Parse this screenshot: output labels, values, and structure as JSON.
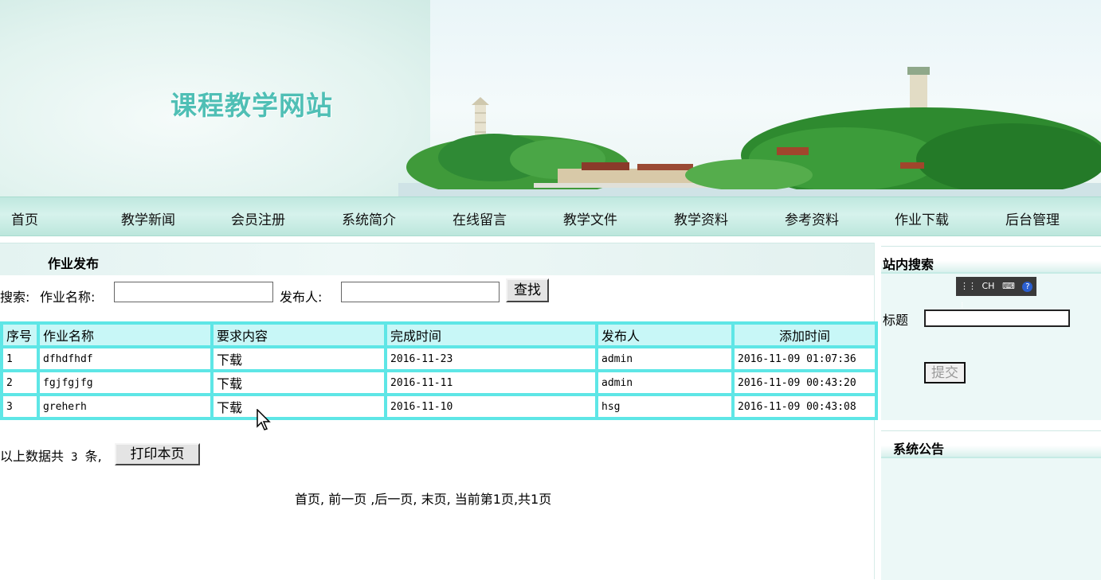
{
  "site": {
    "title": "课程教学网站"
  },
  "nav": [
    "首页",
    "教学新闻",
    "会员注册",
    "系统简介",
    "在线留言",
    "教学文件",
    "教学资料",
    "参考资料",
    "作业下载",
    "后台管理"
  ],
  "section": {
    "title": "作业发布"
  },
  "search": {
    "prefix": "搜索:",
    "name_label": "作业名称:",
    "name_value": "",
    "publisher_label": "发布人:",
    "publisher_value": "",
    "button": "查找"
  },
  "table": {
    "headers": [
      "序号",
      "作业名称",
      "要求内容",
      "完成时间",
      "发布人",
      "添加时间"
    ],
    "rows": [
      {
        "no": "1",
        "name": "dfhdfhdf",
        "req": "下载",
        "due": "2016-11-23",
        "publisher": "admin",
        "added": "2016-11-09 01:07:36"
      },
      {
        "no": "2",
        "name": "fgjfgjfg",
        "req": "下载",
        "due": "2016-11-11",
        "publisher": "admin",
        "added": "2016-11-09 00:43:20"
      },
      {
        "no": "3",
        "name": "greherh",
        "req": "下载",
        "due": "2016-11-10",
        "publisher": "hsg",
        "added": "2016-11-09 00:43:08"
      }
    ]
  },
  "summary": {
    "prefix": "以上数据共",
    "count": "3",
    "suffix": "条,",
    "print_button": "打印本页"
  },
  "pager": {
    "first": "首页,",
    "prev": "前一页",
    "sep1": ",",
    "next": "后一页,",
    "last": "末页,",
    "info": "当前第1页,共1页"
  },
  "sidebar": {
    "search": {
      "title": "站内搜索",
      "ime_text": "CH",
      "label": "标题",
      "value": "",
      "submit": "提交"
    },
    "notice": {
      "title": "系统公告"
    }
  },
  "colors": {
    "table_border": "#5ee6e6",
    "table_header_bg": "#c8f7f7",
    "title_teal": "#4fbfb5"
  }
}
